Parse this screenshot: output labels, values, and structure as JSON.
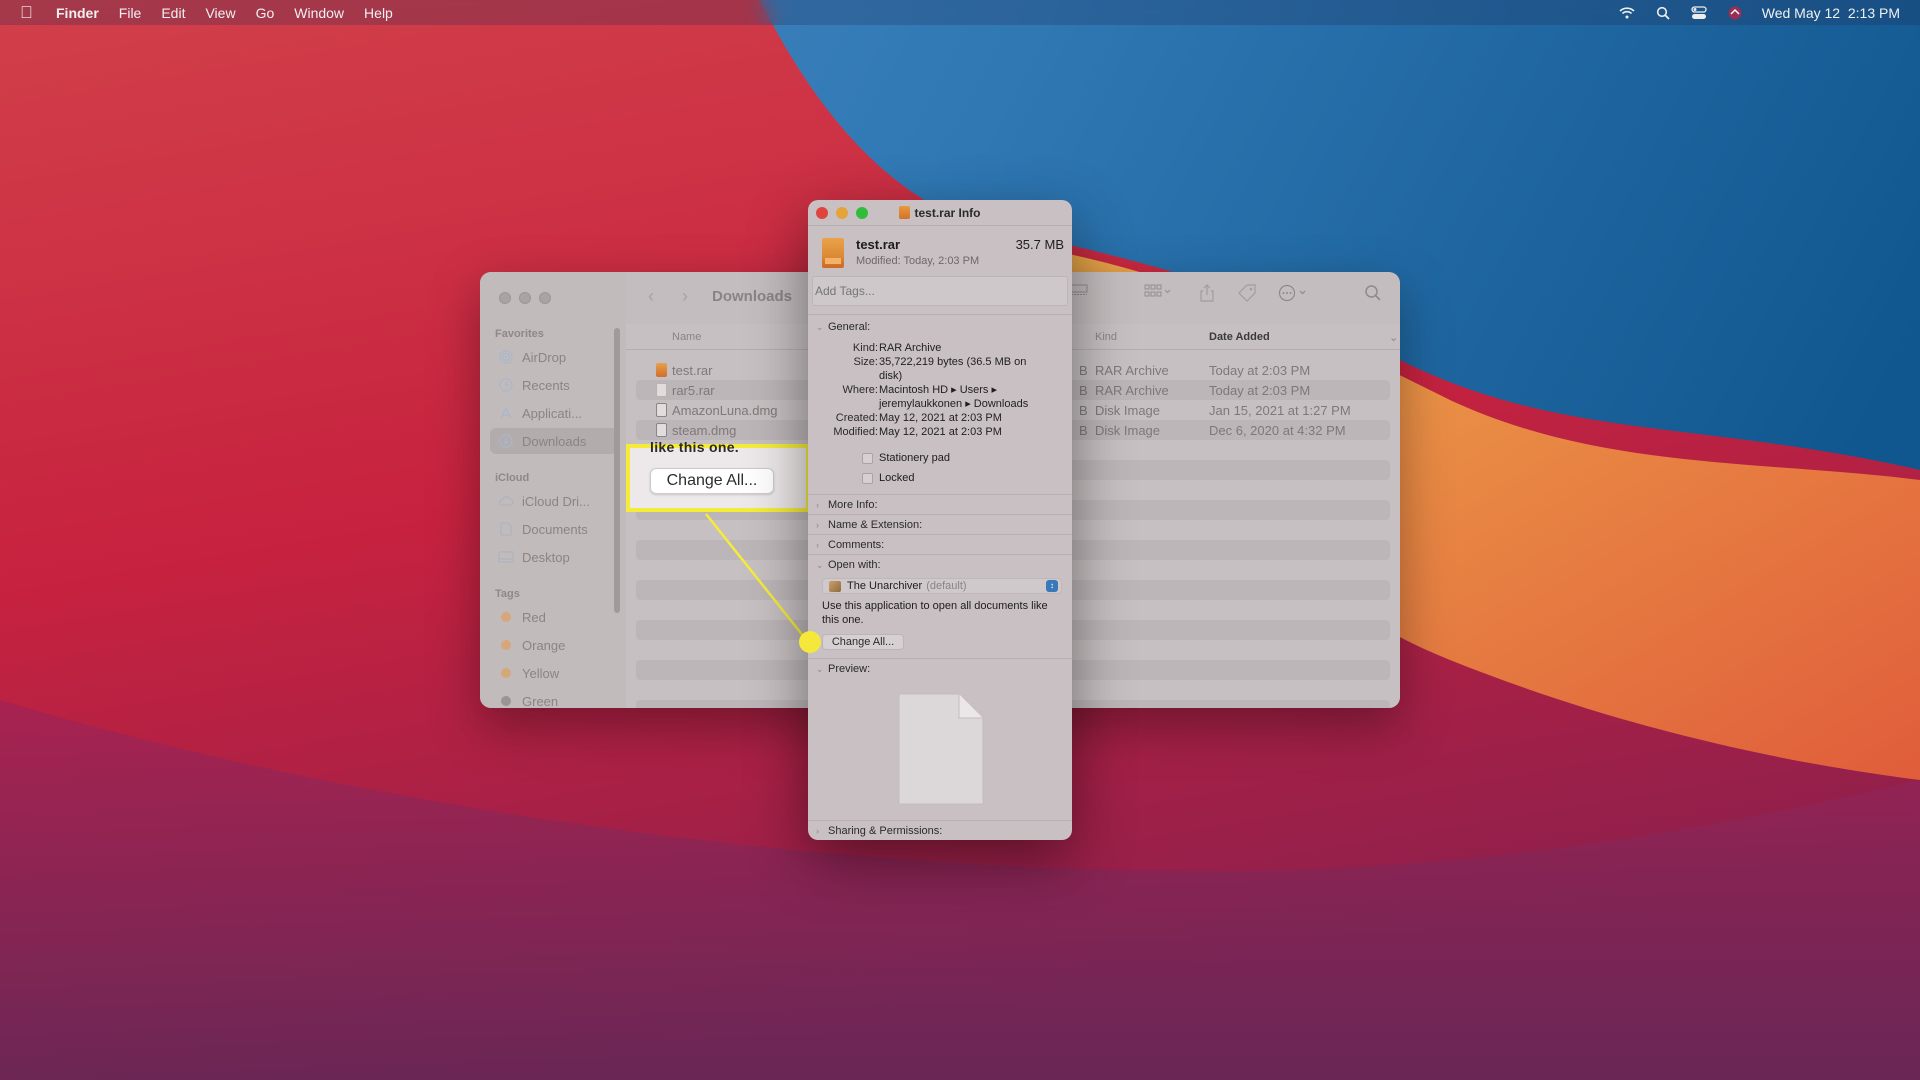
{
  "menubar": {
    "app_name": "Finder",
    "menus": [
      "File",
      "Edit",
      "View",
      "Go",
      "Window",
      "Help"
    ],
    "status_icons": [
      "wifi-icon",
      "spotlight-search-icon",
      "control-center-icon",
      "siri-icon"
    ],
    "clock": "Wed May 12  2:13 PM"
  },
  "finder": {
    "title": "Downloads",
    "sidebar": {
      "favorites_label": "Favorites",
      "favorites": [
        {
          "label": "AirDrop",
          "icon": "airdrop-icon"
        },
        {
          "label": "Recents",
          "icon": "clock-icon"
        },
        {
          "label": "Applicati...",
          "icon": "applications-icon"
        },
        {
          "label": "Downloads",
          "icon": "downloads-icon",
          "active": true
        }
      ],
      "icloud_label": "iCloud",
      "icloud": [
        {
          "label": "iCloud Dri...",
          "icon": "cloud-icon"
        },
        {
          "label": "Documents",
          "icon": "document-icon"
        },
        {
          "label": "Desktop",
          "icon": "desktop-icon"
        }
      ],
      "tags_label": "Tags",
      "tags": [
        {
          "label": "Red",
          "color": "#d9a57a"
        },
        {
          "label": "Orange",
          "color": "#d9a57a"
        },
        {
          "label": "Yellow",
          "color": "#d3a97a"
        },
        {
          "label": "Green",
          "color": "#9a9496"
        }
      ]
    },
    "columns": {
      "name": "Name",
      "kind": "Kind",
      "date_added": "Date Added"
    },
    "files": [
      {
        "name": "test.rar",
        "size_suffix": "B",
        "kind": "RAR Archive",
        "date_added": "Today at 2:03 PM"
      },
      {
        "name": "rar5.rar",
        "size_suffix": "B",
        "kind": "RAR Archive",
        "date_added": "Today at 2:03 PM"
      },
      {
        "name": "AmazonLuna.dmg",
        "size_suffix": "B",
        "kind": "Disk Image",
        "date_added": "Jan 15, 2021 at 1:27 PM"
      },
      {
        "name": "steam.dmg",
        "size_suffix": "B",
        "kind": "Disk Image",
        "date_added": "Dec 6, 2020 at 4:32 PM"
      }
    ]
  },
  "callout": {
    "clipped_text": "like this one.",
    "button_label": "Change All...",
    "highlight_color": "#f5ec3a"
  },
  "info_window": {
    "title": "test.rar Info",
    "file_name": "test.rar",
    "file_size": "35.7 MB",
    "modified_summary": "Modified: Today, 2:03 PM",
    "tags_placeholder": "Add Tags...",
    "general": {
      "header": "General:",
      "kind_label": "Kind:",
      "kind": "RAR Archive",
      "size_label": "Size:",
      "size": "35,722,219 bytes (36.5 MB on disk)",
      "where_label": "Where:",
      "where": "Macintosh HD ▸ Users ▸ jeremylaukkonen ▸ Downloads",
      "created_label": "Created:",
      "created": "May 12, 2021 at 2:03 PM",
      "modified_label": "Modified:",
      "modified": "May 12, 2021 at 2:03 PM",
      "stationery_label": "Stationery pad",
      "stationery_checked": false,
      "locked_label": "Locked",
      "locked_checked": false
    },
    "sections": {
      "more_info": "More Info:",
      "name_extension": "Name & Extension:",
      "comments": "Comments:",
      "open_with": "Open with:",
      "preview": "Preview:",
      "sharing": "Sharing & Permissions:"
    },
    "open_with": {
      "app": "The Unarchiver",
      "default_suffix": "(default)",
      "description": "Use this application to open all documents like this one.",
      "change_all_label": "Change All..."
    }
  }
}
